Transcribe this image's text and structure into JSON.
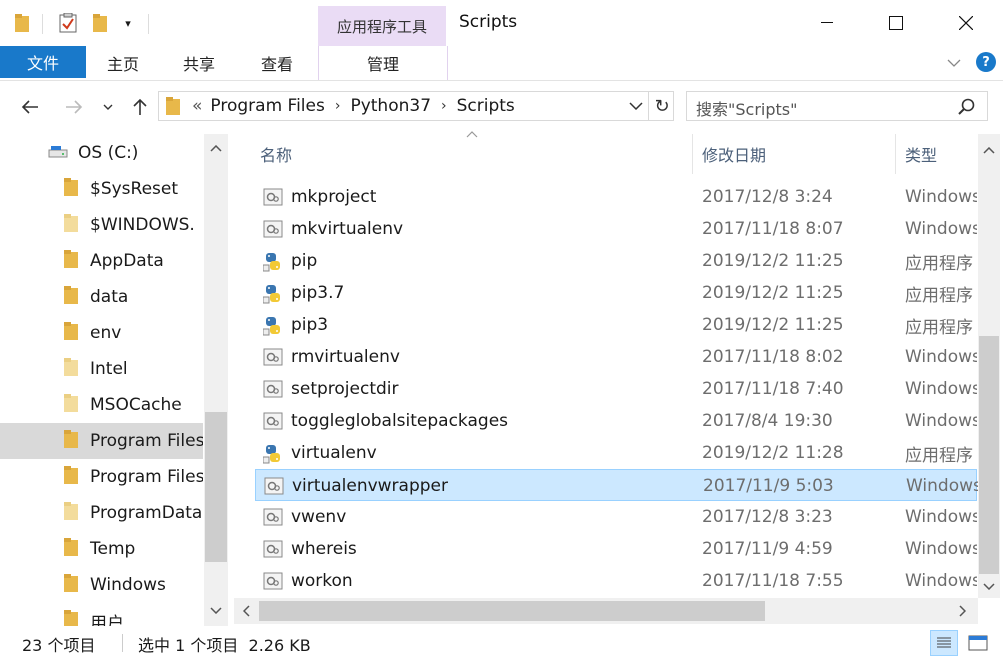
{
  "titlebar": {
    "context_tab": "应用程序工具",
    "title": "Scripts"
  },
  "ribbon": {
    "tabs": [
      "文件",
      "主页",
      "共享",
      "查看"
    ],
    "manage_tab": "管理"
  },
  "address": {
    "overflow": "«",
    "crumbs": [
      "Program Files",
      "Python37",
      "Scripts"
    ]
  },
  "search": {
    "placeholder": "搜索\"Scripts\""
  },
  "nav": {
    "drive": "OS (C:)",
    "items": [
      "$SysReset",
      "$WINDOWS.",
      "AppData",
      "data",
      "env",
      "Intel",
      "MSOCache",
      "Program Files",
      "Program Files",
      "ProgramData",
      "Temp",
      "Windows",
      "用户"
    ],
    "selected_index": 7
  },
  "columns": {
    "name": "名称",
    "date": "修改日期",
    "type": "类型"
  },
  "files": [
    {
      "name": "mkproject",
      "date": "2017/12/8 3:24",
      "type": "Windows",
      "icon": "script-icon"
    },
    {
      "name": "mkvirtualenv",
      "date": "2017/11/18 8:07",
      "type": "Windows",
      "icon": "script-icon"
    },
    {
      "name": "pip",
      "date": "2019/12/2 11:25",
      "type": "应用程序",
      "icon": "python-icon"
    },
    {
      "name": "pip3.7",
      "date": "2019/12/2 11:25",
      "type": "应用程序",
      "icon": "python-icon"
    },
    {
      "name": "pip3",
      "date": "2019/12/2 11:25",
      "type": "应用程序",
      "icon": "python-icon"
    },
    {
      "name": "rmvirtualenv",
      "date": "2017/11/18 8:02",
      "type": "Windows",
      "icon": "script-icon"
    },
    {
      "name": "setprojectdir",
      "date": "2017/11/18 7:40",
      "type": "Windows",
      "icon": "script-icon"
    },
    {
      "name": "toggleglobalsitepackages",
      "date": "2017/8/4 19:30",
      "type": "Windows",
      "icon": "script-icon"
    },
    {
      "name": "virtualenv",
      "date": "2019/12/2 11:28",
      "type": "应用程序",
      "icon": "python-icon"
    },
    {
      "name": "virtualenvwrapper",
      "date": "2017/11/9 5:03",
      "type": "Windows",
      "icon": "script-icon"
    },
    {
      "name": "vwenv",
      "date": "2017/12/8 3:23",
      "type": "Windows",
      "icon": "script-icon"
    },
    {
      "name": "whereis",
      "date": "2017/11/9 4:59",
      "type": "Windows",
      "icon": "script-icon"
    },
    {
      "name": "workon",
      "date": "2017/11/18 7:55",
      "type": "Windows",
      "icon": "script-icon"
    }
  ],
  "selected_file_index": 9,
  "status": {
    "count": "23 个项目",
    "selection": "选中 1 个项目  2.26 KB"
  },
  "colors": {
    "file_tab": "#1979ca",
    "context_tab": "#eadcf5",
    "selection": "#cce8ff",
    "help": "#1979ca"
  }
}
